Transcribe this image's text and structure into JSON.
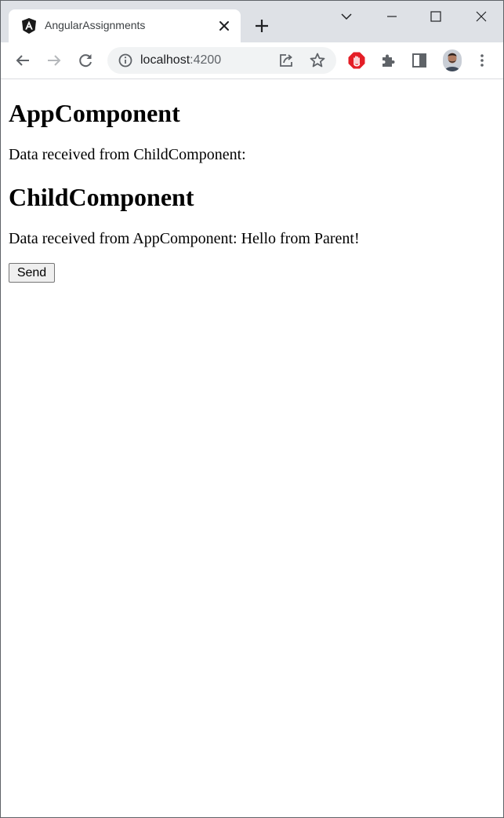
{
  "browser": {
    "tab": {
      "title": "AngularAssignments",
      "favicon": "angular-logo-icon"
    },
    "address_bar": {
      "host": "localhost",
      "port": ":4200"
    },
    "icons": {
      "back": "arrow-left-icon",
      "forward": "arrow-right-icon",
      "reload": "reload-icon",
      "site_info": "info-icon",
      "share": "share-icon",
      "bookmark": "star-icon",
      "adblock": "stop-hand-icon",
      "extensions": "puzzle-icon",
      "side_panel": "side-panel-icon",
      "menu": "kebab-menu-icon"
    },
    "colors": {
      "titlebar": "#dee1e6",
      "omnibox": "#f1f3f4",
      "adblock": "#e41e26"
    }
  },
  "page": {
    "app_heading": "AppComponent",
    "app_text": "Data received from ChildComponent:",
    "child_heading": "ChildComponent",
    "child_text": "Data received from AppComponent: Hello from Parent!",
    "send_label": "Send"
  }
}
